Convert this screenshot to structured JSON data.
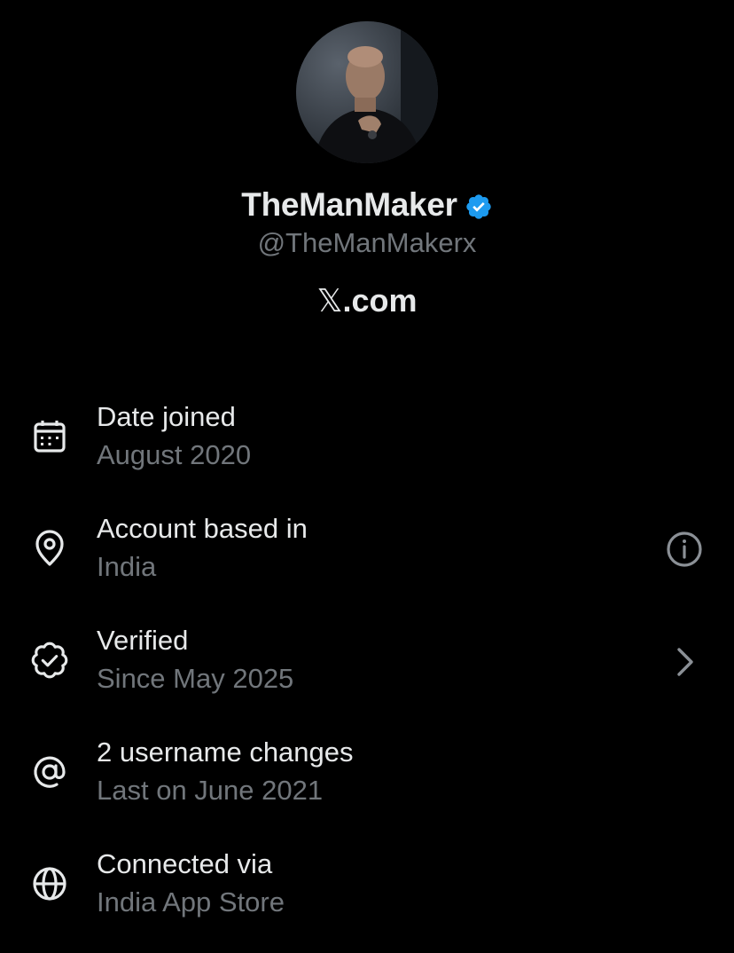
{
  "profile": {
    "display_name": "TheManMaker",
    "handle": "@TheManMakerx",
    "site_brand": "𝕏",
    "site_suffix": ".com",
    "verified_color": "#1d9bf0"
  },
  "about": {
    "items": [
      {
        "icon": "calendar-icon",
        "title": "Date joined",
        "subtitle": "August 2020",
        "action": null
      },
      {
        "icon": "location-pin-icon",
        "title": "Account based in",
        "subtitle": "India",
        "action": "info-icon"
      },
      {
        "icon": "verified-badge-outline-icon",
        "title": "Verified",
        "subtitle": "Since May 2025",
        "action": "chevron-right-icon"
      },
      {
        "icon": "at-sign-icon",
        "title": "2 username changes",
        "subtitle": "Last on June 2021",
        "action": null
      },
      {
        "icon": "globe-icon",
        "title": "Connected via",
        "subtitle": "India App Store",
        "action": null
      }
    ]
  },
  "colors": {
    "background": "#000000",
    "primary_text": "#e7e9ea",
    "secondary_text": "#71767b"
  }
}
